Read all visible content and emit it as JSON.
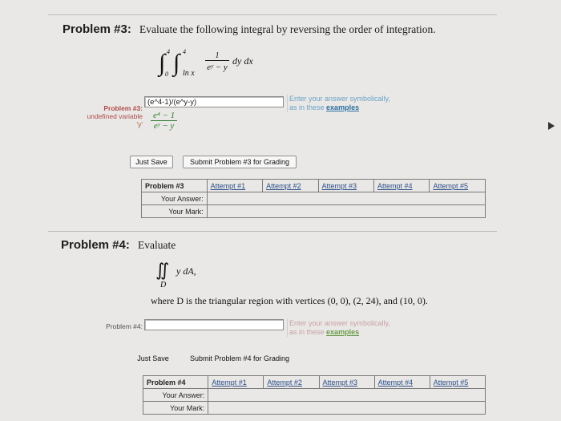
{
  "problem3": {
    "title": "Problem #3:",
    "description": "Evaluate the following integral by reversing the order of integration.",
    "integral": {
      "outer_upper": "4",
      "outer_lower": "0",
      "inner_upper": "4",
      "inner_lower": "ln x",
      "numerator": "1",
      "denominator": "eʸ − y",
      "differentials": "dy dx"
    },
    "side_label": "Problem #3:",
    "error_label": "undefined variable",
    "error_var": "'y'",
    "answer_value": "(e^4-1)/(e^y-y)",
    "preview_numerator": "e⁴ − 1",
    "preview_denominator": "eʸ − y",
    "hint_text": "Enter your answer symbolically,",
    "hint_text2": "as in these",
    "hint_link": "examples",
    "save_button": "Just Save",
    "submit_button": "Submit Problem #3 for Grading",
    "attempts_header": "Problem #3",
    "attempts": [
      "Attempt #1",
      "Attempt #2",
      "Attempt #3",
      "Attempt #4",
      "Attempt #5"
    ],
    "your_answer_label": "Your Answer:",
    "your_mark_label": "Your Mark:"
  },
  "problem4": {
    "title": "Problem #4:",
    "description": "Evaluate",
    "integral_sub": "D",
    "integrand": "y dA,",
    "where_text": "where D is the triangular region with vertices (0, 0), (2, 24), and (10, 0).",
    "side_label": "Problem #4:",
    "answer_value": "",
    "hint_text": "Enter your answer symbolically,",
    "hint_text2": "as in these",
    "hint_link": "examples",
    "save_button": "Just Save",
    "submit_button": "Submit Problem #4 for Grading",
    "attempts_header": "Problem #4",
    "attempts": [
      "Attempt #1",
      "Attempt #2",
      "Attempt #3",
      "Attempt #4",
      "Attempt #5"
    ],
    "your_answer_label": "Your Answer:",
    "your_mark_label": "Your Mark:"
  }
}
